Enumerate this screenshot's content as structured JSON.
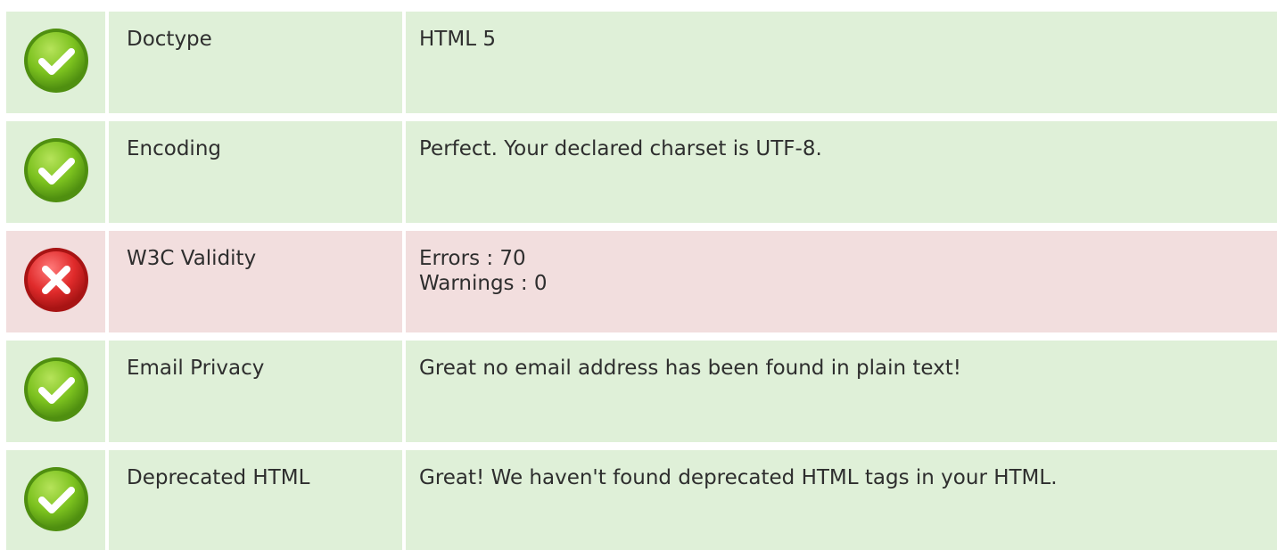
{
  "rows": [
    {
      "status": "ok",
      "icon": "check-circle-icon",
      "name": "Doctype",
      "value_lines": [
        "HTML 5"
      ]
    },
    {
      "status": "ok",
      "icon": "check-circle-icon",
      "name": "Encoding",
      "value_lines": [
        "Perfect. Your declared charset is UTF-8."
      ]
    },
    {
      "status": "error",
      "icon": "error-circle-icon",
      "name": "W3C Validity",
      "value_lines": [
        "Errors : 70",
        "Warnings : 0"
      ]
    },
    {
      "status": "ok",
      "icon": "check-circle-icon",
      "name": "Email Privacy",
      "value_lines": [
        "Great no email address has been found in plain text!"
      ]
    },
    {
      "status": "ok",
      "icon": "check-circle-icon",
      "name": "Deprecated HTML",
      "value_lines": [
        "Great! We haven't found deprecated HTML tags in your HTML."
      ]
    }
  ],
  "colors": {
    "ok_bg": "#dff0d8",
    "error_bg": "#f2dede",
    "ok_icon": "#7cc21f",
    "error_icon": "#e02b2b"
  }
}
